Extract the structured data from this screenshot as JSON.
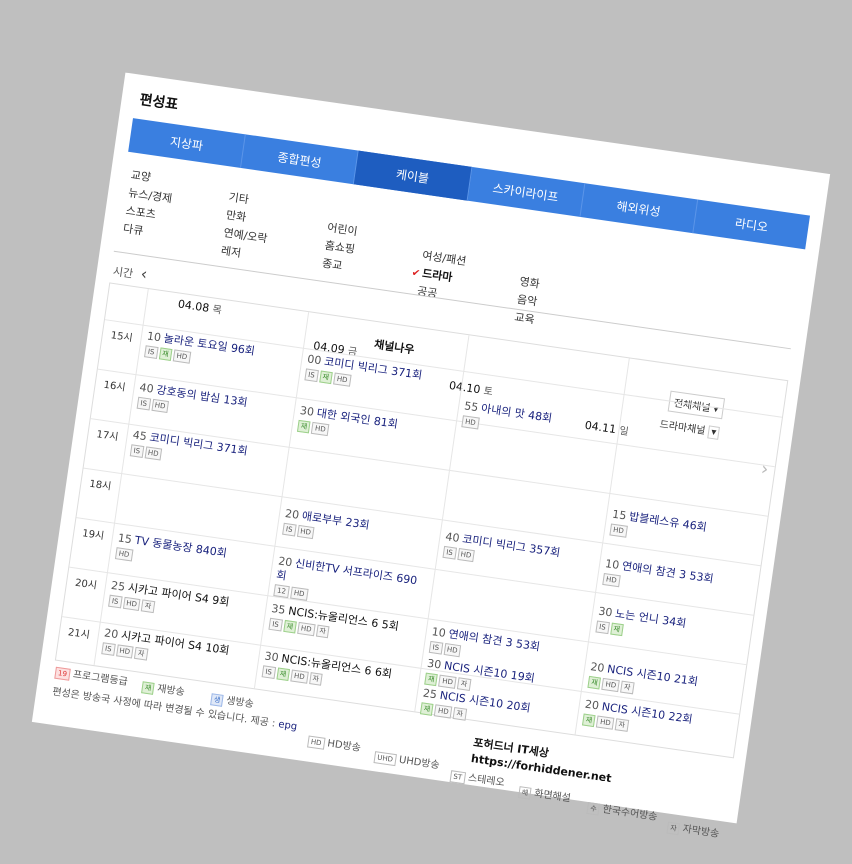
{
  "page_title": "편성표",
  "tabs": [
    {
      "label": "지상파",
      "active": false
    },
    {
      "label": "종합편성",
      "active": false
    },
    {
      "label": "케이블",
      "active": true
    },
    {
      "label": "스카이라이프",
      "active": false
    },
    {
      "label": "해외위성",
      "active": false
    },
    {
      "label": "라디오",
      "active": false
    }
  ],
  "categories": {
    "col1": [
      "교양",
      "뉴스/경제",
      "스포츠",
      "다큐"
    ],
    "col2": [
      "기타",
      "만화",
      "연예/오락",
      "레저"
    ],
    "col3": [
      "어린이",
      "홈쇼핑",
      "종교"
    ],
    "col4": [
      "여성/패션",
      "드라마",
      "공공"
    ],
    "col5": [
      "영화",
      "음악",
      "교육"
    ],
    "selected": "드라마"
  },
  "time_label": "시간",
  "channel": "채널나우",
  "all_channels_label": "전체채널",
  "drama_channels_label": "드라마채널",
  "days": [
    {
      "date": "04.08",
      "weekday": "목"
    },
    {
      "date": "04.09",
      "weekday": "금"
    },
    {
      "date": "04.10",
      "weekday": "토"
    },
    {
      "date": "04.11",
      "weekday": "일"
    }
  ],
  "hours": [
    "15시",
    "16시",
    "17시",
    "18시",
    "19시",
    "20시",
    "21시"
  ],
  "programs": [
    {
      "minute": "10",
      "title": "놀라운 토요일 96회",
      "badges": [
        "IS",
        "재",
        "HD"
      ]
    },
    {
      "minute": "40",
      "title": "강호동의 밥심 13회",
      "badges": [
        "IS",
        "HD"
      ]
    },
    {
      "minute": "45",
      "title": "코미디 빅리그 371회",
      "badges": [
        "IS",
        "HD"
      ]
    },
    {
      "minute": "15",
      "title": "TV 동물농장 840회",
      "badges": [
        "HD"
      ]
    },
    {
      "minute": "25",
      "title": "시카고 파이어 S4 9회",
      "badges": [
        "IS",
        "HD",
        "자"
      ]
    },
    {
      "minute": "20",
      "title": "시카고 파이어 S4 10회",
      "badges": [
        "IS",
        "HD",
        "자"
      ]
    },
    {
      "minute": "00",
      "title": "코미디 빅리그 371회",
      "badges": [
        "IS",
        "재",
        "HD"
      ]
    },
    {
      "minute": "30",
      "title": "대한 외국인 81회",
      "badges": [
        "재",
        "HD"
      ]
    },
    {
      "minute": "20",
      "title": "애로부부 23회",
      "badges": [
        "IS",
        "HD"
      ]
    },
    {
      "minute": "20",
      "title": "신비한TV 서프라이즈 690회",
      "badges": [
        "12",
        "HD"
      ]
    },
    {
      "minute": "35",
      "title": "NCIS:뉴올리언스 6 5회",
      "badges": [
        "IS",
        "재",
        "HD",
        "자"
      ]
    },
    {
      "minute": "30",
      "title": "NCIS:뉴올리언스 6 6회",
      "badges": [
        "IS",
        "재",
        "HD",
        "자"
      ]
    },
    {
      "minute": "55",
      "title": "아내의 맛 48회",
      "badges": [
        "HD"
      ]
    },
    {
      "minute": "40",
      "title": "코미디 빅리그 357회",
      "badges": [
        "IS",
        "HD"
      ]
    },
    {
      "minute": "10",
      "title": "연애의 참견 3 53회",
      "badges": [
        "IS",
        "HD"
      ]
    },
    {
      "minute": "30",
      "title": "NCIS 시즌10 19회",
      "badges": [
        "재",
        "HD",
        "자"
      ]
    },
    {
      "minute": "25",
      "title": "NCIS 시즌10 20회",
      "badges": [
        "재",
        "HD",
        "자"
      ]
    },
    {
      "minute": "15",
      "title": "밥블레스유 46회",
      "badges": [
        "HD"
      ]
    },
    {
      "minute": "10",
      "title": "연애의 참견 3 53회",
      "badges": [
        "HD"
      ]
    },
    {
      "minute": "30",
      "title": "노는 언니 34회",
      "badges": [
        "IS",
        "재"
      ]
    },
    {
      "minute": "20",
      "title": "NCIS 시즌10 21회",
      "badges": [
        "재",
        "HD",
        "자"
      ]
    },
    {
      "minute": "20",
      "title": "NCIS 시즌10 22회",
      "badges": [
        "재",
        "HD",
        "자"
      ]
    }
  ],
  "legend": {
    "rating": "프로그램등급",
    "rerun": "재방송",
    "live": "생방송",
    "hd": "HD방송",
    "uhd": "UHD방송",
    "stereo": "스테레오",
    "commentary": "화면해설",
    "sign": "한국수어방송",
    "subtitle": "자막방송",
    "notice": "편성은 방송국 사정에 따라 변경될 수 있습니다.",
    "provider_label": "제공 :",
    "provider": "epg"
  },
  "watermark": {
    "line1": "포허드너 IT세상",
    "line2": "https://forhiddener.net"
  }
}
